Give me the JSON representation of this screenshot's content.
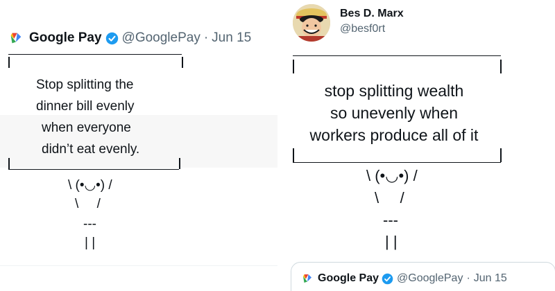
{
  "left_tweet": {
    "author_name": "Google Pay",
    "handle": "@GooglePay",
    "separator": "·",
    "date": "Jun 15",
    "sign_lines": [
      "Stop splitting the",
      "dinner bill evenly",
      "when everyone",
      "didn’t eat evenly."
    ],
    "bunny_face": "\\ (•◡•) /",
    "bunny_arms": "\\     /",
    "bunny_body": "---",
    "bunny_legs": "| |"
  },
  "right_tweet": {
    "author_name": "Bes D. Marx",
    "handle": "@besf0rt",
    "sign_lines": [
      "stop splitting wealth",
      "so unevenly when",
      "workers produce all of it"
    ],
    "bunny_face": "\\ (•◡•) /",
    "bunny_arms": "\\     /",
    "bunny_body": "---",
    "bunny_legs": "| |",
    "quoted": {
      "author_name": "Google Pay",
      "handle": "@GooglePay",
      "separator": "·",
      "date": "Jun 15"
    }
  },
  "colors": {
    "verified_blue": "#1d9bf0",
    "secondary_text": "#536471",
    "gray_band": "#f7f7f7"
  },
  "icons": [
    "google-pay-logo-icon",
    "verified-badge-icon",
    "avatar"
  ]
}
